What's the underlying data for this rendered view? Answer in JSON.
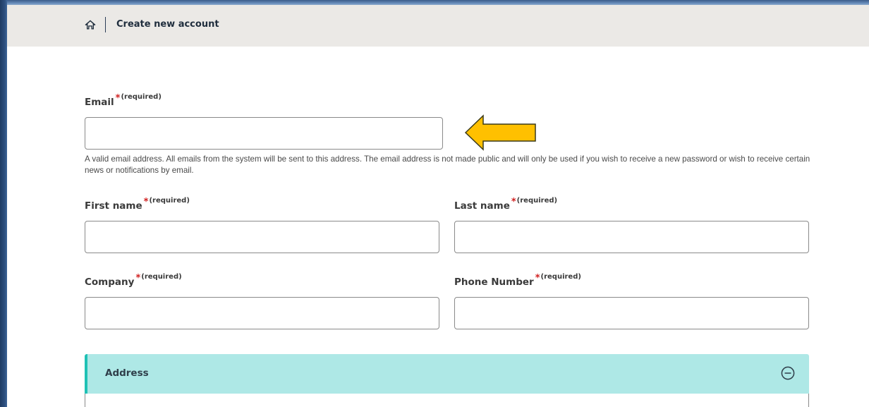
{
  "breadcrumb": {
    "home_icon": "home-icon",
    "current": "Create new account"
  },
  "required_marker": {
    "star": "*",
    "text": "(required)",
    "star_color": "#d02020"
  },
  "form": {
    "email": {
      "label": "Email",
      "value": "",
      "help": "A valid email address. All emails from the system will be sent to this address. The email address is not made public and will only be used if you wish to receive a new password or wish to receive certain news or notifications by email."
    },
    "first_name": {
      "label": "First name",
      "value": ""
    },
    "last_name": {
      "label": "Last name",
      "value": ""
    },
    "company": {
      "label": "Company",
      "value": ""
    },
    "phone": {
      "label": "Phone Number",
      "value": ""
    }
  },
  "address_section": {
    "title": "Address",
    "toggle_icon": "minus-circle-icon",
    "expanded": true,
    "accent_color": "#1fc1b5",
    "background_color": "#aee8e6"
  },
  "annotation": {
    "icon": "arrow-left-icon",
    "color": "#ffc000"
  }
}
